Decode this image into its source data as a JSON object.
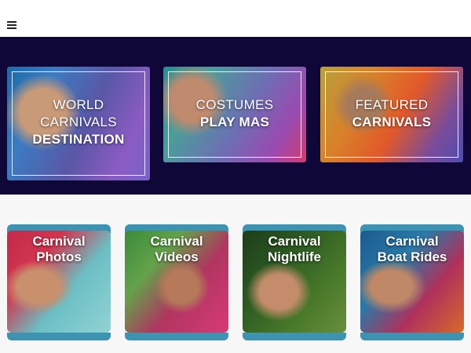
{
  "header": {
    "menu_icon": "hamburger-menu-icon"
  },
  "featured": [
    {
      "line1": "WORLD",
      "line2": "CARNIVALS",
      "line3": "DESTINATION"
    },
    {
      "line1": "COSTUMES",
      "line2": "PLAY MAS"
    },
    {
      "line1": "FEATURED",
      "line2": "CARNIVALS"
    }
  ],
  "categories": [
    {
      "line1": "Carnival",
      "line2": "Photos"
    },
    {
      "line1": "Carnival",
      "line2": "Videos"
    },
    {
      "line1": "Carnival",
      "line2": "Nightlife"
    },
    {
      "line1": "Carnival",
      "line2": "Boat Rides"
    }
  ],
  "colors": {
    "hero_bg": "#0e0738",
    "card_accent": "#3c93b2"
  }
}
